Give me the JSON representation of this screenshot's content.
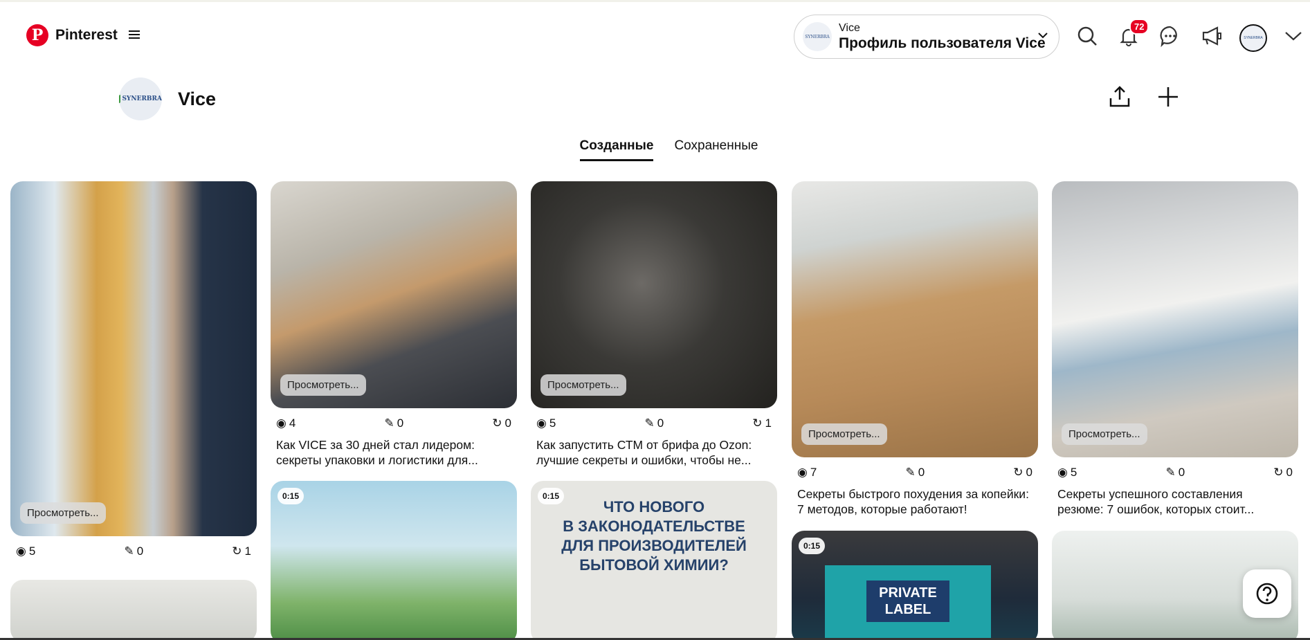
{
  "brand": {
    "name": "Pinterest",
    "logo_letter": "P"
  },
  "account": {
    "small": "Vice",
    "big": "Профиль пользователя Vice",
    "avatar_text": "SYNERBRA"
  },
  "notifications": {
    "count": "72"
  },
  "profile": {
    "name": "Vice",
    "avatar_text": "SYNERBRA"
  },
  "tabs": [
    {
      "label": "Созданные"
    },
    {
      "label": "Сохраненные"
    }
  ],
  "pins": [
    {
      "views": "5",
      "saves": "0",
      "reactions": "1",
      "view_label": "Просмотреть...",
      "title1": "",
      "title2": ""
    },
    {
      "views": "4",
      "saves": "0",
      "reactions": "0",
      "view_label": "Просмотреть...",
      "title1": "Как VICE за 30 дней стал лидером:",
      "title2": "секреты упаковки и логистики для..."
    },
    {
      "views": "5",
      "saves": "0",
      "reactions": "1",
      "view_label": "Просмотреть...",
      "title1": "Как запустить СТМ от брифа до Ozon:",
      "title2": "лучшие секреты и ошибки, чтобы не..."
    },
    {
      "views": "7",
      "saves": "0",
      "reactions": "0",
      "view_label": "Просмотреть...",
      "title1": "Секреты быстрого похудения за копейки:",
      "title2": "7 методов, которые работают!"
    },
    {
      "views": "5",
      "saves": "0",
      "reactions": "0",
      "view_label": "Просмотреть...",
      "title1": "Секреты успешного составления",
      "title2": "резюме: 7 ошибок, которых стоит..."
    }
  ],
  "videos": [
    {
      "duration": "0:15"
    },
    {
      "duration": "0:15",
      "line1": "ЧТО НОВОГО",
      "line2": "В ЗАКОНОДАТЕЛЬСТВЕ",
      "line3": "ДЛЯ ПРОИЗВОДИТЕЛЕЙ",
      "line4": "БЫТОВОЙ ХИМИИ?"
    },
    {
      "duration": "0:15",
      "label1": "PRIVATE",
      "label2": "LABEL"
    }
  ],
  "colors": {
    "brand": "#e60023"
  }
}
